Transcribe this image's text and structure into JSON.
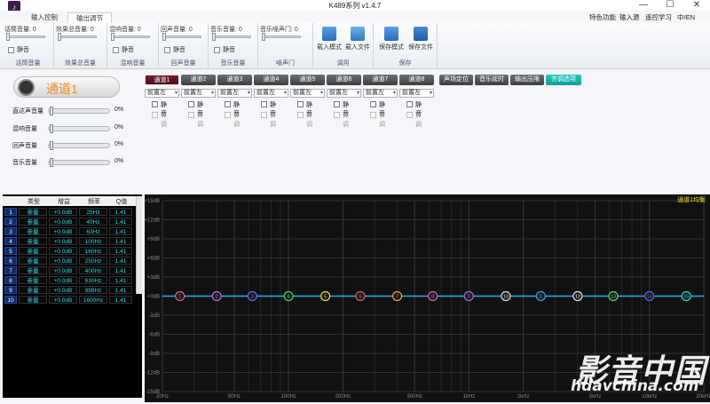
{
  "window": {
    "title": "K489系列 v1.4.7",
    "minimize": "—",
    "maximize": "☐",
    "close": "✕"
  },
  "tabs": [
    {
      "label": "输入控制"
    },
    {
      "label": "输出调节"
    }
  ],
  "menu_right": [
    {
      "label": "特色功能"
    },
    {
      "label": "输入源"
    },
    {
      "label": "遥控学习"
    },
    {
      "label": "中/EN"
    }
  ],
  "ribbon": {
    "groups": [
      {
        "label": "话筒音量: 0",
        "check": "静音",
        "name": "话筒音量"
      },
      {
        "label": "效果总音量: 0",
        "check": "",
        "name": "效果总音量"
      },
      {
        "label": "混响音量: 0",
        "check": "静音",
        "name": "混响音量"
      },
      {
        "label": "回声音量: 0",
        "check": "静音",
        "name": "回声音量"
      },
      {
        "label": "音乐音量: 0",
        "check": "静音",
        "name": "音乐音量"
      },
      {
        "label": "音乐噪声门: 0",
        "check": "",
        "name": "噪声门"
      }
    ],
    "call": {
      "name": "调用",
      "load_mode": "载入模式",
      "load_file": "载入文件"
    },
    "save": {
      "name": "保存",
      "save_mode": "保存模式",
      "save_file": "保存文件"
    }
  },
  "channel": {
    "name": "通道1",
    "sliders": [
      {
        "label": "直达声音量",
        "value": "0%"
      },
      {
        "label": "混响音量",
        "value": "0%"
      },
      {
        "label": "回声音量",
        "value": "0%"
      },
      {
        "label": "音乐音量",
        "value": "0%"
      }
    ]
  },
  "channel_tabs": [
    "通道1",
    "通道2",
    "通道3",
    "通道4",
    "通道5",
    "通道6",
    "通道7",
    "通道8"
  ],
  "function_tabs": [
    "声场定位",
    "音乐延时",
    "输出压限",
    "齐调选项"
  ],
  "position_select": "前置左",
  "mute_label": "静音",
  "align_label": "齐调",
  "peq": {
    "headers": [
      "类型",
      "增益",
      "频率",
      "Q值"
    ],
    "rows": [
      {
        "n": "1",
        "type": "参量",
        "gain": "+0.0dB",
        "freq": "25Hz",
        "q": "1.41"
      },
      {
        "n": "2",
        "type": "参量",
        "gain": "+0.0dB",
        "freq": "40Hz",
        "q": "1.41"
      },
      {
        "n": "3",
        "type": "参量",
        "gain": "+0.0dB",
        "freq": "63Hz",
        "q": "1.41"
      },
      {
        "n": "4",
        "type": "参量",
        "gain": "+0.0dB",
        "freq": "100Hz",
        "q": "1.41"
      },
      {
        "n": "5",
        "type": "参量",
        "gain": "+0.0dB",
        "freq": "160Hz",
        "q": "1.41"
      },
      {
        "n": "6",
        "type": "参量",
        "gain": "+0.0dB",
        "freq": "250Hz",
        "q": "1.41"
      },
      {
        "n": "7",
        "type": "参量",
        "gain": "+0.0dB",
        "freq": "400Hz",
        "q": "1.41"
      },
      {
        "n": "8",
        "type": "参量",
        "gain": "+0.0dB",
        "freq": "630Hz",
        "q": "1.41"
      },
      {
        "n": "9",
        "type": "参量",
        "gain": "+0.0dB",
        "freq": "998Hz",
        "q": "1.41"
      },
      {
        "n": "10",
        "type": "参量",
        "gain": "+0.0dB",
        "freq": "1600Hz",
        "q": "1.41"
      }
    ]
  },
  "chart_data": {
    "type": "line",
    "title": "通道1均衡",
    "ylim": [
      -15,
      15
    ],
    "yticks": [
      "+15dB",
      "+12dB",
      "+9dB",
      "+6dB",
      "+3dB",
      "+0dB",
      "-3dB",
      "-6dB",
      "-9dB",
      "-12dB",
      "-15dB"
    ],
    "xticks": [
      "20Hz",
      "50Hz",
      "100Hz",
      "200Hz",
      "500Hz",
      "1kHz",
      "2kHz",
      "5kHz",
      "10kHz",
      "20kHz"
    ],
    "xtick_values": [
      20,
      50,
      100,
      200,
      500,
      1000,
      2000,
      5000,
      10000,
      20000
    ],
    "bands": [
      {
        "n": "1",
        "freq": 25,
        "gain": 0,
        "color": "#e0608a"
      },
      {
        "n": "2",
        "freq": 40,
        "gain": 0,
        "color": "#b070e0"
      },
      {
        "n": "3",
        "freq": 63,
        "gain": 0,
        "color": "#6a6ae8"
      },
      {
        "n": "4",
        "freq": 100,
        "gain": 0,
        "color": "#4ad26a"
      },
      {
        "n": "5",
        "freq": 160,
        "gain": 0,
        "color": "#e8d840"
      },
      {
        "n": "6",
        "freq": 250,
        "gain": 0,
        "color": "#e06060"
      },
      {
        "n": "7",
        "freq": 400,
        "gain": 0,
        "color": "#e8a040"
      },
      {
        "n": "8",
        "freq": 630,
        "gain": 0,
        "color": "#d060c0"
      },
      {
        "n": "9",
        "freq": 998,
        "gain": 0,
        "color": "#a070e0"
      },
      {
        "n": "10",
        "freq": 1600,
        "gain": 0,
        "color": "#e0e0e0"
      },
      {
        "n": "11",
        "freq": 2500,
        "gain": 0,
        "color": "#40a0e0"
      },
      {
        "n": "12",
        "freq": 4000,
        "gain": 0,
        "color": "#e0e0e0"
      },
      {
        "n": "13",
        "freq": 6300,
        "gain": 0,
        "color": "#60d060"
      },
      {
        "n": "14",
        "freq": 10000,
        "gain": 0,
        "color": "#6060e0"
      },
      {
        "n": "15",
        "freq": 16000,
        "gain": 0,
        "color": "#40d0d0"
      }
    ],
    "line_color": "#2aa8f0",
    "grid": true
  },
  "watermark": {
    "line1": "影音中国",
    "line2": "hdavchina.com"
  }
}
